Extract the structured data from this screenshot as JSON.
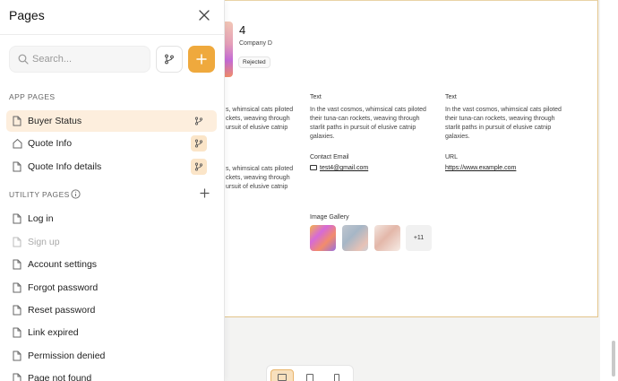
{
  "panel": {
    "title": "Pages",
    "search_placeholder": "Search...",
    "app_section_label": "APP PAGES",
    "utility_section_label": "UTILITY PAGES",
    "app_pages": [
      {
        "label": "Buyer Status",
        "icon": "file-icon"
      },
      {
        "label": "Quote Info",
        "icon": "home-icon"
      },
      {
        "label": "Quote Info details",
        "icon": "file-icon"
      }
    ],
    "utility_pages": [
      {
        "label": "Log in"
      },
      {
        "label": "Sign up"
      },
      {
        "label": "Account settings"
      },
      {
        "label": "Forgot password"
      },
      {
        "label": "Reset password"
      },
      {
        "label": "Link expired"
      },
      {
        "label": "Permission denied"
      },
      {
        "label": "Page not found"
      }
    ]
  },
  "record": {
    "title": "4",
    "company": "Company D",
    "status": "Rejected",
    "fields": {
      "text_label_1": "Text",
      "text_label_2": "Text",
      "text_value": "In the vast cosmos, whimsical cats piloted their tuna-can rockets, weaving through starlit paths in pursuit of elusive catnip galaxies.",
      "partial_text_1": "s, whimsical cats piloted\nckets, weaving through\nursuit of elusive catnip",
      "partial_text_2": "s, whimsical cats piloted\nckets, weaving through\nursuit of elusive catnip",
      "contact_email_label": "Contact Email",
      "contact_email": "test4@gmail.com",
      "url_label": "URL",
      "url": "https://www.example.com",
      "image_gallery_label": "Image Gallery",
      "gallery_more": "+11"
    }
  },
  "colors": {
    "accent": "#efa93d",
    "selected_bg": "#fdeedd",
    "frame_border": "#e3c48a"
  }
}
